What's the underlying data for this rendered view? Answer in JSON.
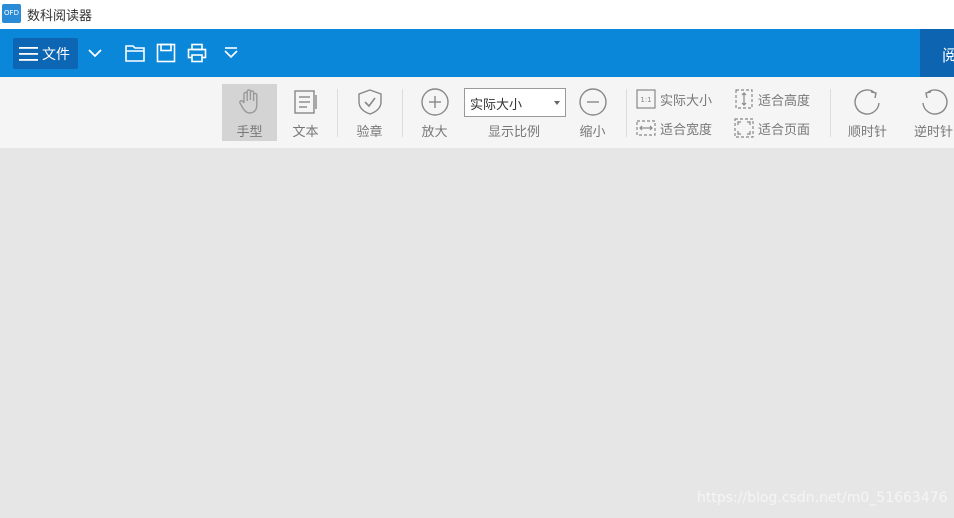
{
  "app": {
    "title": "数科阅读器",
    "icon_text": "OFD"
  },
  "menubar": {
    "file_label": "文件",
    "reader_tab_label": "阅读"
  },
  "toolbar": {
    "hand_label": "手型",
    "text_label": "文本",
    "verify_label": "验章",
    "zoom_in_label": "放大",
    "zoom_value": "实际大小",
    "zoom_ratio_label": "显示比例",
    "zoom_out_label": "缩小",
    "actual_size_label": "实际大小",
    "fit_width_label": "适合宽度",
    "fit_height_label": "适合高度",
    "fit_page_label": "适合页面",
    "rotate_cw_label": "顺时针",
    "rotate_ccw_label": "逆时针"
  },
  "watermark": "https://blog.csdn.net/m0_51663476",
  "colors": {
    "menubar": "#0a87d9",
    "active_button": "#0d66b3",
    "toolbar": "#f5f5f5",
    "canvas": "#e6e6e6"
  }
}
